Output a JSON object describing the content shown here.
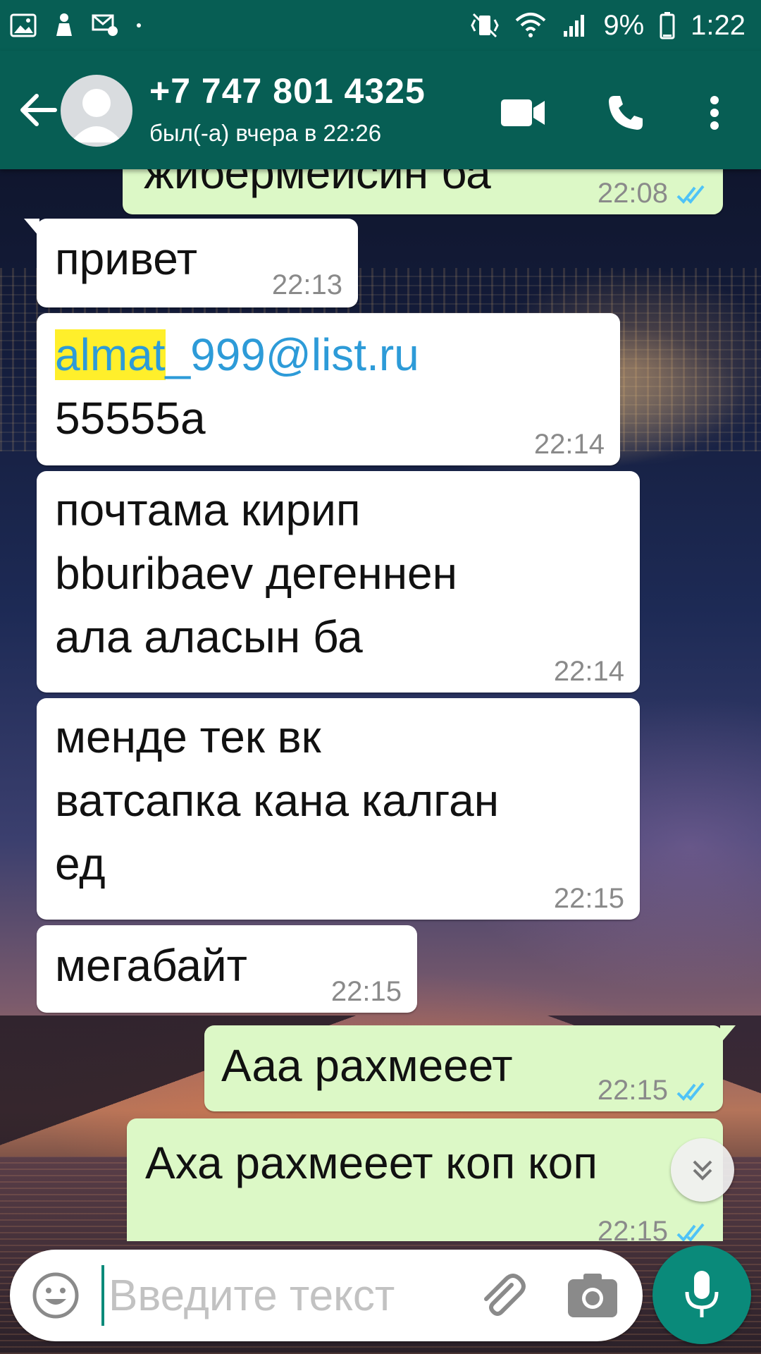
{
  "statusbar": {
    "battery": "9%",
    "time": "1:22",
    "left_icons": [
      "image-icon",
      "person-clean-icon",
      "settings-mail-icon",
      "dot-icon"
    ],
    "right_icons": [
      "vibrate-icon",
      "wifi-icon",
      "signal-icon",
      "battery-icon"
    ]
  },
  "header": {
    "contact_name": "+7 747 801 4325",
    "last_seen": "был(-а) вчера в 22:26",
    "color": "#075e54"
  },
  "messages": [
    {
      "dir": "out",
      "text": "жибермейсин ба",
      "time": "22:08",
      "read": true,
      "partial": true
    },
    {
      "dir": "in",
      "text": "привет",
      "time": "22:13"
    },
    {
      "dir": "in",
      "text_highlight": "almat",
      "text_link": "_999@list.ru",
      "text": "55555a",
      "time": "22:14"
    },
    {
      "dir": "in",
      "text": "почтама кирип\nbburibaev дегеннен\nала аласын ба",
      "time": "22:14"
    },
    {
      "dir": "in",
      "text": "менде тек вк\nватсапка кана калган\nед",
      "time": "22:15"
    },
    {
      "dir": "in",
      "text": "мегабайт",
      "time": "22:15"
    },
    {
      "dir": "out",
      "text": "Ааа рахмееет",
      "time": "22:15",
      "read": true
    },
    {
      "dir": "out",
      "text": "Аха рахмееет коп коп",
      "time": "22:15",
      "read": true
    }
  ],
  "composer": {
    "placeholder": "Введите текст",
    "value": ""
  },
  "colors": {
    "outgoing_bubble": "#dcf8c6",
    "incoming_bubble": "#ffffff",
    "accent": "#0a8a7a",
    "read_ticks": "#4fc3f7"
  }
}
